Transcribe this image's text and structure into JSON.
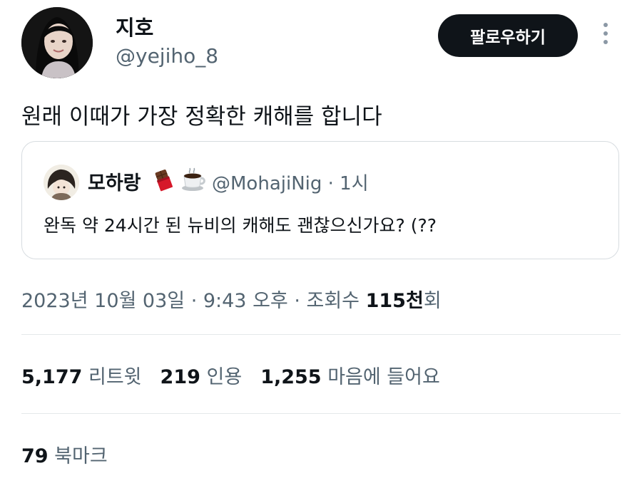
{
  "author": {
    "display_name": "지호",
    "handle": "@yejiho_8",
    "avatar_icon": "user-avatar"
  },
  "actions": {
    "follow_label": "팔로우하기",
    "more_icon": "more-vertical-icon"
  },
  "tweet": {
    "text": "원래 이때가 가장 정확한 캐해를 합니다"
  },
  "quote": {
    "display_name": "모하랑",
    "emojis": [
      "chocolate-bar-icon",
      "hot-coffee-icon"
    ],
    "handle_time": "@MohajiNig · 1시",
    "text": "완독 약 24시간 된 뉴비의 캐해도 괜찮으신가요? (??"
  },
  "meta": {
    "datetime": "2023년 10월 03일 · 9:43 오후 · 조회수 ",
    "views_number": "115천",
    "views_suffix": "회"
  },
  "stats": {
    "retweets_count": "5,177",
    "retweets_label": "리트윗",
    "quotes_count": "219",
    "quotes_label": "인용",
    "likes_count": "1,255",
    "likes_label": "마음에 들어요"
  },
  "bookmarks": {
    "count": "79",
    "label": "북마크"
  },
  "colors": {
    "text": "#0f1419",
    "secondary": "#536471",
    "border": "#d7dce0",
    "button_bg": "#0f1419"
  }
}
